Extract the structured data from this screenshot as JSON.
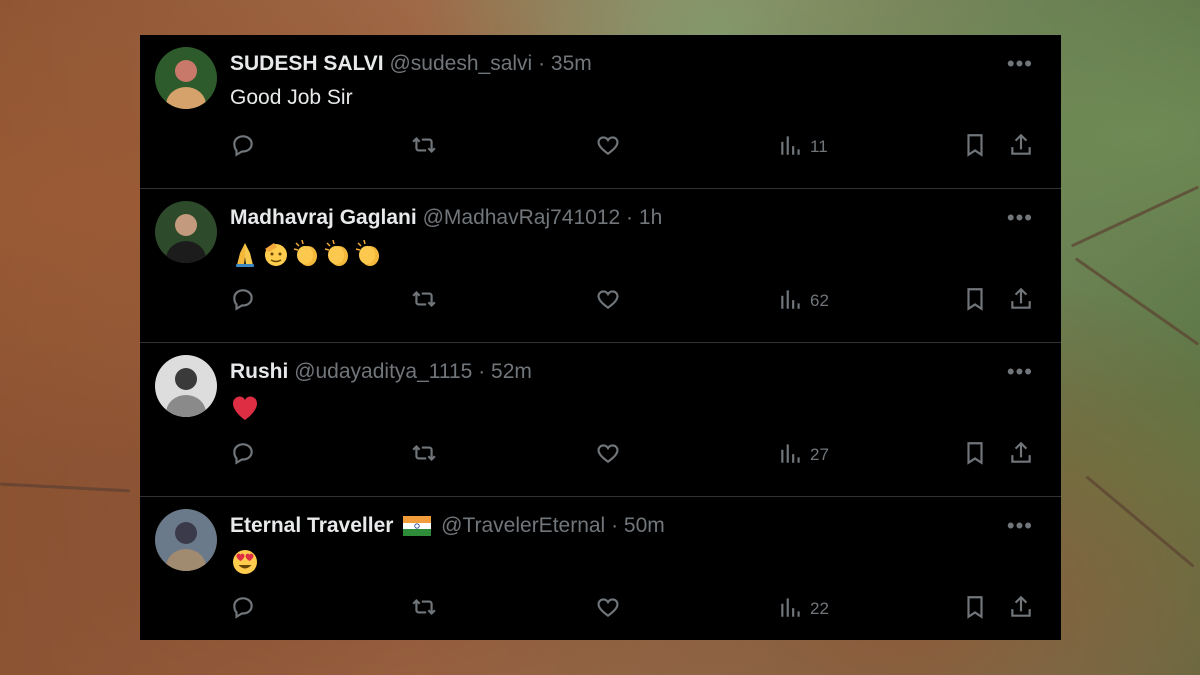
{
  "tweets": [
    {
      "name": "SUDESH SALVI",
      "flag": "",
      "handle": "@sudesh_salvi",
      "sep": "·",
      "time": "35m",
      "text": "Good Job Sir",
      "emojis": [],
      "views": "11",
      "avatar_colors": [
        "#2e5b2b",
        "#c8796a",
        "#d6a26b"
      ]
    },
    {
      "name": "Madhavraj Gaglani",
      "flag": "",
      "handle": "@MadhavRaj741012",
      "sep": "·",
      "time": "1h",
      "text": "",
      "emojis": [
        "folded-hands-emoji",
        "saluting-face-emoji",
        "clapping-hands-emoji",
        "clapping-hands-emoji",
        "clapping-hands-emoji"
      ],
      "views": "62",
      "avatar_colors": [
        "#2d4a2a",
        "#c49a7e",
        "#1c1c1c"
      ]
    },
    {
      "name": "Rushi",
      "flag": "",
      "handle": "@udayaditya_1115",
      "sep": "·",
      "time": "52m",
      "text": "",
      "emojis": [
        "red-heart-emoji"
      ],
      "views": "27",
      "avatar_colors": [
        "#dddddd",
        "#3a3a3a",
        "#8a8a8a"
      ]
    },
    {
      "name": "Eternal Traveller",
      "flag": "india-flag-emoji",
      "handle": "@TravelerEternal",
      "sep": "·",
      "time": "50m",
      "text": "",
      "emojis": [
        "heart-eyes-emoji"
      ],
      "views": "22",
      "avatar_colors": [
        "#6b7a8a",
        "#3b3a4a",
        "#a08a70"
      ]
    }
  ],
  "more_label": "•••",
  "colors": {
    "panel_bg": "#000000",
    "name": "#e7e9ea",
    "muted": "#71767b",
    "divider": "#2f3336"
  }
}
